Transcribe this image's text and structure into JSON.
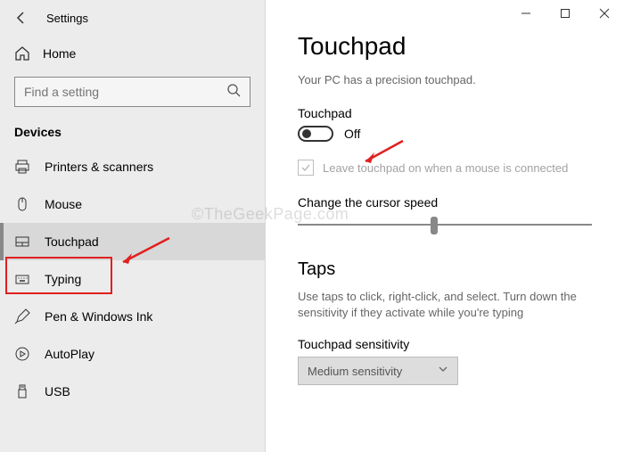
{
  "window": {
    "title": "Settings",
    "min_tooltip": "Minimize",
    "max_tooltip": "Maximize",
    "close_tooltip": "Close"
  },
  "sidebar": {
    "home_label": "Home",
    "search_placeholder": "Find a setting",
    "group_header": "Devices",
    "items": [
      {
        "label": "Printers & scanners",
        "icon": "printer"
      },
      {
        "label": "Mouse",
        "icon": "mouse"
      },
      {
        "label": "Touchpad",
        "icon": "touchpad",
        "selected": true
      },
      {
        "label": "Typing",
        "icon": "keyboard"
      },
      {
        "label": "Pen & Windows Ink",
        "icon": "pen"
      },
      {
        "label": "AutoPlay",
        "icon": "autoplay"
      },
      {
        "label": "USB",
        "icon": "usb"
      }
    ]
  },
  "main": {
    "heading": "Touchpad",
    "subtext": "Your PC has a precision touchpad.",
    "toggle": {
      "label": "Touchpad",
      "state_text": "Off",
      "value": false
    },
    "checkbox": {
      "label": "Leave touchpad on when a mouse is connected",
      "checked": true,
      "disabled": true
    },
    "slider": {
      "label": "Change the cursor speed",
      "value": 5,
      "min": 0,
      "max": 10
    },
    "taps": {
      "heading": "Taps",
      "desc": "Use taps to click, right-click, and select. Turn down the sensitivity if they activate while you're typing",
      "sensitivity_label": "Touchpad sensitivity",
      "sensitivity_value": "Medium sensitivity"
    }
  },
  "watermark": "©TheGeekPage.com"
}
